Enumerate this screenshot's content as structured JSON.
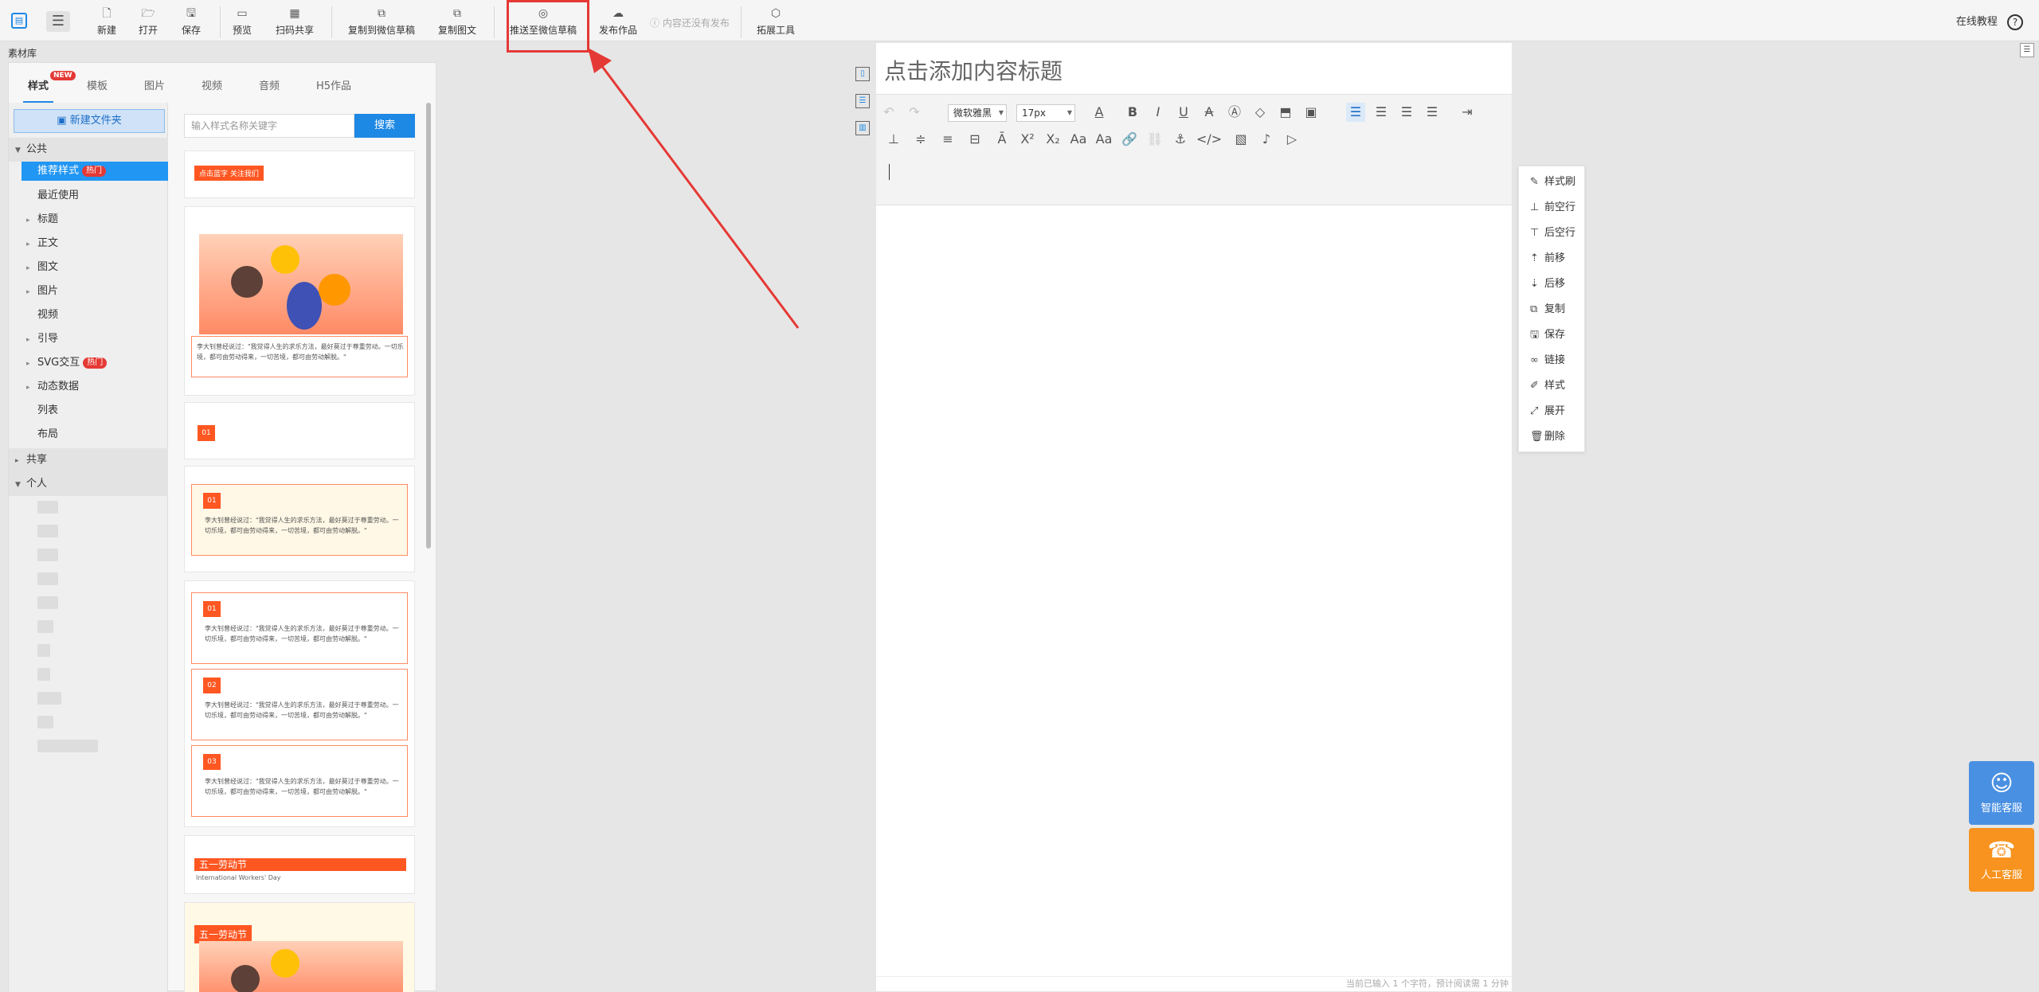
{
  "toolbar": {
    "new": "新建",
    "open": "打开",
    "save": "保存",
    "preview": "预览",
    "scan_share": "扫码共享",
    "copy_to_wechat_draft": "复制到微信草稿",
    "copy_text": "复制图文",
    "push_to_wechat_draft": "推送至微信草稿",
    "publish": "发布作品",
    "status": "内容还没有发布",
    "expand_tools": "拓展工具",
    "help": "在线教程",
    "help_icon": "?"
  },
  "library": {
    "title": "素材库",
    "tabs": [
      "样式",
      "模板",
      "图片",
      "视频",
      "音频",
      "H5作品"
    ],
    "new_badge": "NEW",
    "new_folder": "新建文件夹",
    "hot_label": "热门",
    "groups": {
      "public": "公共",
      "shared": "共享",
      "personal": "个人"
    },
    "items": [
      "推荐样式",
      "最近使用",
      "标题",
      "正文",
      "图文",
      "图片",
      "视频",
      "引导",
      "SVG交互",
      "动态数据",
      "列表",
      "布局"
    ],
    "search_placeholder": "输入样式名称关键字",
    "search_button": "搜索"
  },
  "previews": {
    "tag1": "点击蓝字 关注我们",
    "quote": "李大钊曾经说过：\"我觉得人生的求乐方法，最好莫过于尊重劳动。一切乐境，都可由劳动得来，一切苦境，都可由劳动解脱。\"",
    "num01": "01",
    "num02": "02",
    "num03": "03",
    "labor_day": "五一劳动节",
    "labor_day_en": "International Workers' Day"
  },
  "editor": {
    "title_placeholder": "点击添加内容标题",
    "font": "微软雅黑",
    "size": "17px",
    "footer": "当前已输入 1 个字符，预计阅读需 1 分钟"
  },
  "context_menu": [
    "样式刷",
    "前空行",
    "后空行",
    "前移",
    "后移",
    "复制",
    "保存",
    "链接",
    "样式",
    "展开",
    "删除"
  ],
  "service": {
    "ai": "智能客服",
    "human": "人工客服"
  },
  "colors": {
    "accent": "#1e88e5",
    "highlight": "#e53935",
    "orange": "#ff5722",
    "ai_service": "#4a90e2",
    "human_service": "#f7931e"
  }
}
